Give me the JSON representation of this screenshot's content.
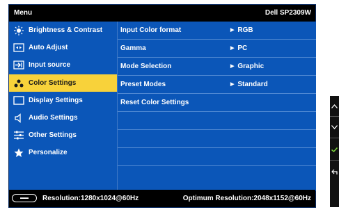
{
  "header": {
    "title": "Menu",
    "model": "Dell SP2309W"
  },
  "sidebar": {
    "items": [
      {
        "label": "Brightness & Contrast",
        "icon": "brightness-icon"
      },
      {
        "label": "Auto Adjust",
        "icon": "auto-adjust-icon"
      },
      {
        "label": "Input source",
        "icon": "input-source-icon"
      },
      {
        "label": "Color Settings",
        "icon": "color-settings-icon",
        "selected": true
      },
      {
        "label": "Display Settings",
        "icon": "display-settings-icon"
      },
      {
        "label": "Audio Settings",
        "icon": "audio-icon"
      },
      {
        "label": "Other Settings",
        "icon": "other-settings-icon"
      },
      {
        "label": "Personalize",
        "icon": "star-icon"
      }
    ]
  },
  "content": {
    "rows": [
      {
        "label": "Input Color format",
        "value": "RGB"
      },
      {
        "label": "Gamma",
        "value": "PC"
      },
      {
        "label": "Mode Selection",
        "value": "Graphic"
      },
      {
        "label": "Preset Modes",
        "value": "Standard"
      },
      {
        "label": "Reset Color Settings",
        "value": ""
      }
    ]
  },
  "footer": {
    "resolution": "Resolution:1280x1024@60Hz",
    "optimum": "Optimum Resolution:2048x1152@60Hz"
  },
  "colors": {
    "panel": "#0b56b8",
    "highlight": "#f8d23a",
    "bar": "#000000"
  }
}
